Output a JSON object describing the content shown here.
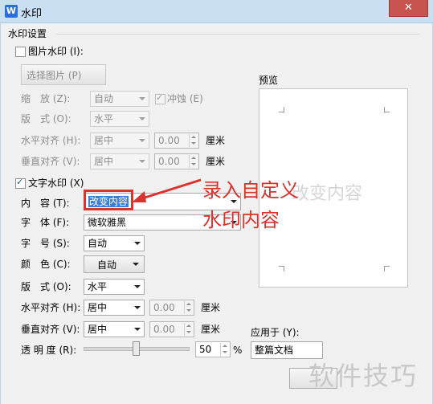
{
  "window": {
    "title": "水印",
    "app_icon_letter": "W",
    "close_glyph": "✕"
  },
  "settings_group": {
    "title": "水印设置"
  },
  "picture_watermark": {
    "checkbox_label": "图片水印 (I):",
    "select_picture_button": "选择图片 (P)",
    "scale_label": "缩　放 (Z):",
    "scale_value": "自动",
    "washout_label": "冲蚀 (E)",
    "layout_label": "版　式 (O):",
    "layout_value": "水平",
    "h_align_label": "水平对齐 (H):",
    "h_align_value": "居中",
    "h_offset_value": "0.00",
    "h_unit": "厘米",
    "v_align_label": "垂直对齐 (V):",
    "v_align_value": "居中",
    "v_offset_value": "0.00",
    "v_unit": "厘米"
  },
  "text_watermark": {
    "checkbox_label": "文字水印 (X)",
    "content_label": "内　容 (T):",
    "content_value": "改变内容",
    "font_label": "字　体 (F):",
    "font_value": "微软雅黑",
    "size_label": "字　号 (S):",
    "size_value": "自动",
    "color_label": "颜　色 (C):",
    "color_value": "自动",
    "layout_label": "版　式 (O):",
    "layout_value": "水平",
    "h_align_label": "水平对齐 (H):",
    "h_align_value": "居中",
    "h_offset_value": "0.00",
    "h_unit": "厘米",
    "v_align_label": "垂直对齐 (V):",
    "v_align_value": "居中",
    "v_offset_value": "0.00",
    "v_unit": "厘米",
    "transparency_label": "透 明 度 (R):",
    "transparency_value": "50",
    "transparency_level": 0.5,
    "transparency_unit": "%"
  },
  "preview": {
    "label": "预览",
    "watermark_text": "改变内容"
  },
  "apply_to": {
    "label": "应用于 (Y):",
    "value": "整篇文档"
  },
  "annotation": {
    "line1": "录入自定义",
    "line2": "水印内容"
  },
  "overlay_watermark": "软件技巧",
  "colors": {
    "annotation_red": "#d9322f",
    "selection_blue": "#3c7fd1",
    "titlebar": "#c9dff2"
  }
}
